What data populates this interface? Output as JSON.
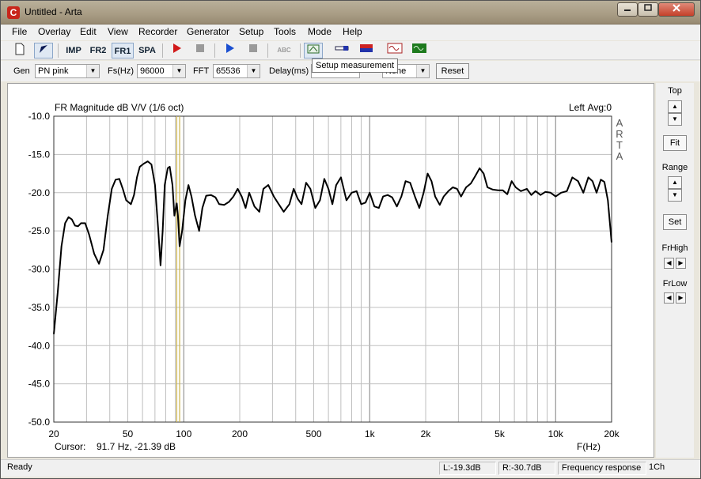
{
  "window": {
    "title": "Untitled - Arta",
    "app_icon": "C"
  },
  "menu": [
    "File",
    "Overlay",
    "Edit",
    "View",
    "Recorder",
    "Generator",
    "Setup",
    "Tools",
    "Mode",
    "Help"
  ],
  "toolbar": {
    "imp_label": "IMP",
    "fr2_label": "FR2",
    "fr1_label": "FR1",
    "spa_label": "SPA",
    "abc_label": "ABC",
    "tooltip": "Setup measurement",
    "colors": {
      "record_red": "#d11a1a",
      "play_blue": "#1a4fd1",
      "disabled": "#9a9a9a"
    }
  },
  "settings": {
    "gen_label": "Gen",
    "gen_value": "PN pink",
    "fs_label": "Fs(Hz)",
    "fs_value": "96000",
    "fft_label": "FFT",
    "fft_value": "65536",
    "delay_label": "Delay(ms)",
    "delay_value": "",
    "avg_value": "None",
    "reset_label": "Reset"
  },
  "plot": {
    "title": "FR Magnitude dB V/V (1/6 oct)",
    "channel": "Left",
    "avg": "Avg:0",
    "watermark": [
      "A",
      "R",
      "T",
      "A"
    ],
    "cursor_label": "Cursor:",
    "cursor_value": "91.7 Hz, -21.39 dB",
    "x_axis_label": "F(Hz)",
    "colors": {
      "grid": "#bfbfbf",
      "curve": "#000000",
      "cursor": "#c9b24a"
    }
  },
  "chart_data": {
    "type": "line",
    "title": "FR Magnitude dB V/V (1/6 oct)",
    "xlabel": "F(Hz)",
    "ylabel": "",
    "x_scale": "log",
    "xlim": [
      20,
      20000
    ],
    "ylim": [
      -50,
      -10
    ],
    "x_ticks": [
      20,
      50,
      100,
      200,
      500,
      1000,
      2000,
      5000,
      10000,
      20000
    ],
    "x_tick_labels": [
      "20",
      "50",
      "100",
      "200",
      "500",
      "1k",
      "2k",
      "5k",
      "10k",
      "20k"
    ],
    "y_ticks": [
      -10,
      -15,
      -20,
      -25,
      -30,
      -35,
      -40,
      -45,
      -50
    ],
    "y_tick_labels": [
      "-10.0",
      "-15.0",
      "-20.0",
      "-25.0",
      "-30.0",
      "-35.0",
      "-40.0",
      "-45.0",
      "-50.0"
    ],
    "grid": true,
    "cursor_freq": [
      91.7,
      95
    ],
    "series": [
      {
        "values": [
          [
            20,
            -38.5
          ],
          [
            21,
            -33
          ],
          [
            22,
            -27
          ],
          [
            23,
            -24
          ],
          [
            24,
            -23.2
          ],
          [
            25,
            -23.5
          ],
          [
            26,
            -24.3
          ],
          [
            27,
            -24.4
          ],
          [
            28,
            -24
          ],
          [
            29.5,
            -24
          ],
          [
            31,
            -25.5
          ],
          [
            33,
            -28
          ],
          [
            35,
            -29.3
          ],
          [
            37,
            -27.5
          ],
          [
            39,
            -23
          ],
          [
            41,
            -19.5
          ],
          [
            43,
            -18.3
          ],
          [
            45,
            -18.2
          ],
          [
            47,
            -19.5
          ],
          [
            49,
            -21
          ],
          [
            52,
            -21.5
          ],
          [
            54,
            -20.3
          ],
          [
            56,
            -18
          ],
          [
            58,
            -16.6
          ],
          [
            61,
            -16.2
          ],
          [
            64,
            -15.9
          ],
          [
            67,
            -16.3
          ],
          [
            70,
            -19
          ],
          [
            73,
            -25
          ],
          [
            75,
            -29.5
          ],
          [
            77,
            -25
          ],
          [
            79,
            -19
          ],
          [
            82,
            -16.8
          ],
          [
            84,
            -16.6
          ],
          [
            87,
            -19
          ],
          [
            89,
            -23
          ],
          [
            91.7,
            -21.4
          ],
          [
            93,
            -23
          ],
          [
            95,
            -27
          ],
          [
            98,
            -25
          ],
          [
            102,
            -21
          ],
          [
            106,
            -19
          ],
          [
            110,
            -20.5
          ],
          [
            115,
            -23
          ],
          [
            121,
            -25
          ],
          [
            126,
            -22
          ],
          [
            132,
            -20.4
          ],
          [
            140,
            -20.3
          ],
          [
            148,
            -20.6
          ],
          [
            155,
            -21.5
          ],
          [
            165,
            -21.6
          ],
          [
            175,
            -21.2
          ],
          [
            185,
            -20.5
          ],
          [
            195,
            -19.5
          ],
          [
            205,
            -20.5
          ],
          [
            215,
            -22
          ],
          [
            225,
            -20
          ],
          [
            240,
            -21.8
          ],
          [
            255,
            -22.5
          ],
          [
            268,
            -19.5
          ],
          [
            285,
            -19
          ],
          [
            305,
            -20.5
          ],
          [
            320,
            -21.3
          ],
          [
            345,
            -22.5
          ],
          [
            370,
            -21.5
          ],
          [
            390,
            -19.5
          ],
          [
            410,
            -20.8
          ],
          [
            430,
            -21.5
          ],
          [
            455,
            -18.7
          ],
          [
            480,
            -19.5
          ],
          [
            510,
            -22
          ],
          [
            540,
            -21
          ],
          [
            570,
            -18.2
          ],
          [
            600,
            -19.5
          ],
          [
            630,
            -21.5
          ],
          [
            660,
            -19
          ],
          [
            700,
            -18
          ],
          [
            750,
            -21
          ],
          [
            800,
            -20
          ],
          [
            850,
            -19.8
          ],
          [
            900,
            -21.5
          ],
          [
            950,
            -21.3
          ],
          [
            1000,
            -20
          ],
          [
            1060,
            -21.8
          ],
          [
            1120,
            -22
          ],
          [
            1180,
            -20.5
          ],
          [
            1250,
            -20.3
          ],
          [
            1320,
            -20.6
          ],
          [
            1400,
            -21.8
          ],
          [
            1480,
            -20.5
          ],
          [
            1560,
            -18.5
          ],
          [
            1650,
            -18.7
          ],
          [
            1750,
            -20.5
          ],
          [
            1850,
            -22
          ],
          [
            1950,
            -20
          ],
          [
            2050,
            -17.5
          ],
          [
            2150,
            -18.5
          ],
          [
            2250,
            -20.5
          ],
          [
            2380,
            -21.6
          ],
          [
            2500,
            -20.5
          ],
          [
            2650,
            -19.8
          ],
          [
            2800,
            -19.3
          ],
          [
            2950,
            -19.5
          ],
          [
            3100,
            -20.5
          ],
          [
            3300,
            -19.3
          ],
          [
            3500,
            -18.8
          ],
          [
            3700,
            -17.8
          ],
          [
            3900,
            -16.8
          ],
          [
            4100,
            -17.5
          ],
          [
            4300,
            -19.3
          ],
          [
            4600,
            -19.6
          ],
          [
            4900,
            -19.7
          ],
          [
            5200,
            -19.7
          ],
          [
            5500,
            -20.2
          ],
          [
            5800,
            -18.5
          ],
          [
            6100,
            -19.3
          ],
          [
            6500,
            -19.8
          ],
          [
            7000,
            -19.5
          ],
          [
            7400,
            -20.3
          ],
          [
            7800,
            -19.8
          ],
          [
            8300,
            -20.3
          ],
          [
            8800,
            -19.9
          ],
          [
            9400,
            -20
          ],
          [
            10000,
            -20.5
          ],
          [
            10700,
            -20
          ],
          [
            11500,
            -19.8
          ],
          [
            12300,
            -18
          ],
          [
            13200,
            -18.5
          ],
          [
            14100,
            -20
          ],
          [
            15000,
            -18
          ],
          [
            15800,
            -18.5
          ],
          [
            16600,
            -20
          ],
          [
            17500,
            -18.3
          ],
          [
            18300,
            -18.6
          ],
          [
            19100,
            -21
          ],
          [
            20000,
            -26.5
          ]
        ]
      }
    ]
  },
  "side_panel": {
    "top_label": "Top",
    "fit_label": "Fit",
    "range_label": "Range",
    "set_label": "Set",
    "frhigh_label": "FrHigh",
    "frlow_label": "FrLow"
  },
  "status": {
    "ready": "Ready",
    "left_level": "L:-19.3dB",
    "right_level": "R:-30.7dB",
    "mode": "Frequency response",
    "channels": "1Ch"
  }
}
